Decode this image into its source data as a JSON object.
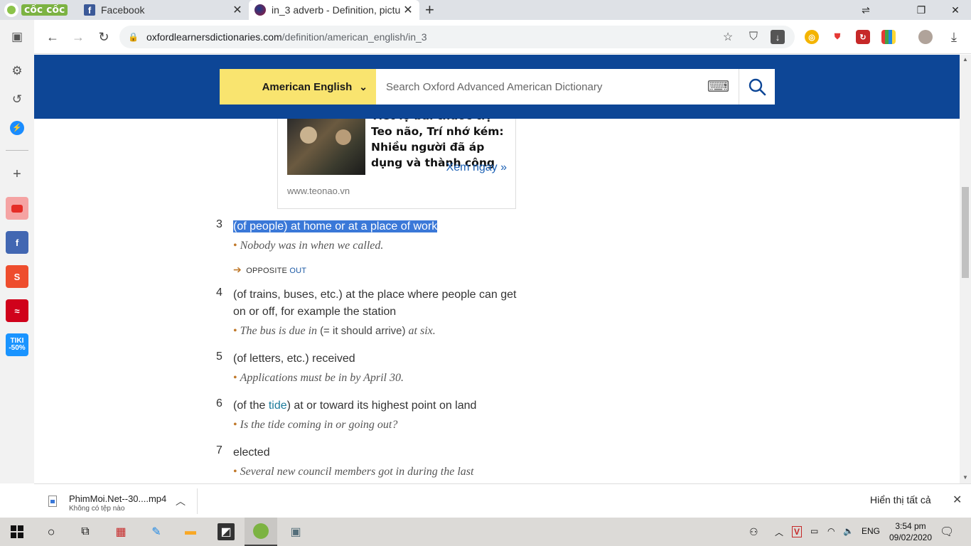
{
  "browser": {
    "brand": "cốc cốc",
    "tabs": [
      {
        "title": "Facebook"
      },
      {
        "title": "in_3 adverb - Definition, pictu"
      }
    ],
    "new_tab": "+",
    "url_host": "oxfordlearnersdictionaries.com",
    "url_path": "/definition/american_english/in_3"
  },
  "header": {
    "dictionary_select": "American English",
    "search_placeholder": "Search Oxford Advanced American Dictionary"
  },
  "ad": {
    "title": "Tiết lộ bài thuốc trị Teo não, Trí nhớ kém: Nhiều người đã áp dụng và thành công",
    "cta": "Xem ngay »",
    "domain": "www.teonao.vn"
  },
  "senses": [
    {
      "num": "3",
      "definition": "(of people) at home or at a place of work",
      "example": "Nobody was in when we called.",
      "xref_label": "OPPOSITE",
      "xref_word": "OUT"
    },
    {
      "num": "4",
      "definition_line1": "(of trains, buses, etc.) at the place where people can get",
      "definition_line2": "on or off, for example the station",
      "example_a": "The bus is due in",
      "example_gloss": "(= it should arrive)",
      "example_b": "at six."
    },
    {
      "num": "5",
      "definition": "(of letters, etc.) received",
      "example": "Applications must be in by April 30."
    },
    {
      "num": "6",
      "definition_pre": "(of the",
      "definition_link": "tide",
      "definition_post": ") at or toward its highest point on land",
      "example": "Is the tide coming in or going out?"
    },
    {
      "num": "7",
      "definition": "elected",
      "example": "Several new council members got in during the last"
    }
  ],
  "downloads": {
    "file_name": "PhimMoi.Net--30....mp4",
    "status": "Không có tệp nào",
    "show_all": "Hiển thị tất cả"
  },
  "taskbar": {
    "language": "ENG",
    "time": "3:54 pm",
    "date": "09/02/2020"
  },
  "colors": {
    "header_blue": "#0d4696",
    "select_yellow": "#f9e46f",
    "highlight": "#3a78d8",
    "bullet_orange": "#c0792b"
  }
}
